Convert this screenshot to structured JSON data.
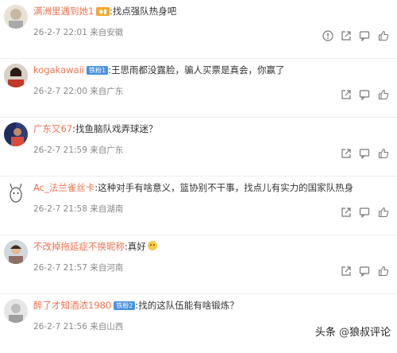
{
  "comments": [
    {
      "username": "满洲里遇到她1",
      "badge": "",
      "text": ":找点强队热身吧",
      "date": "26-2-7 22:01",
      "source": "来自安徽",
      "has_emoji": false
    },
    {
      "username": "kogakawaii",
      "badge": "铁粉1",
      "text": ":王思雨都没露脸，骗人买票是真会，你赢了",
      "date": "26-2-7 22:00",
      "source": "来自广东",
      "has_emoji": false
    },
    {
      "username": "广东又67",
      "badge": "",
      "text": ":找鱼脑队戏弄球迷？",
      "date": "26-2-7 21:59",
      "source": "来自广东",
      "has_emoji": false
    },
    {
      "username": "Ac_法兰雀丝卡",
      "badge": "",
      "text": ":这种对手有啥意义，篮协别不干事，找点儿有实力的国家队热身",
      "date": "26-2-7 21:58",
      "source": "来自湖南",
      "has_emoji": false
    },
    {
      "username": "不改掉拖延症不换昵称",
      "badge": "",
      "text": ":真好",
      "date": "26-2-7 21:57",
      "source": "来自河南",
      "has_emoji": true
    },
    {
      "username": "醉了才知酒浓1980",
      "badge": "铁粉2",
      "text": ":找的这队伍能有啥锻炼？",
      "date": "26-2-7 21:56",
      "source": "来自山西",
      "has_emoji": false
    }
  ],
  "icons": [
    "report-icon",
    "share-icon",
    "comment-icon",
    "like-icon"
  ],
  "watermark": {
    "prefix": "头条",
    "at": "@",
    "handle": "狼叔评论"
  },
  "colors": {
    "username": "#eb7350",
    "badge": "#4a90e2",
    "meta": "#888888"
  }
}
